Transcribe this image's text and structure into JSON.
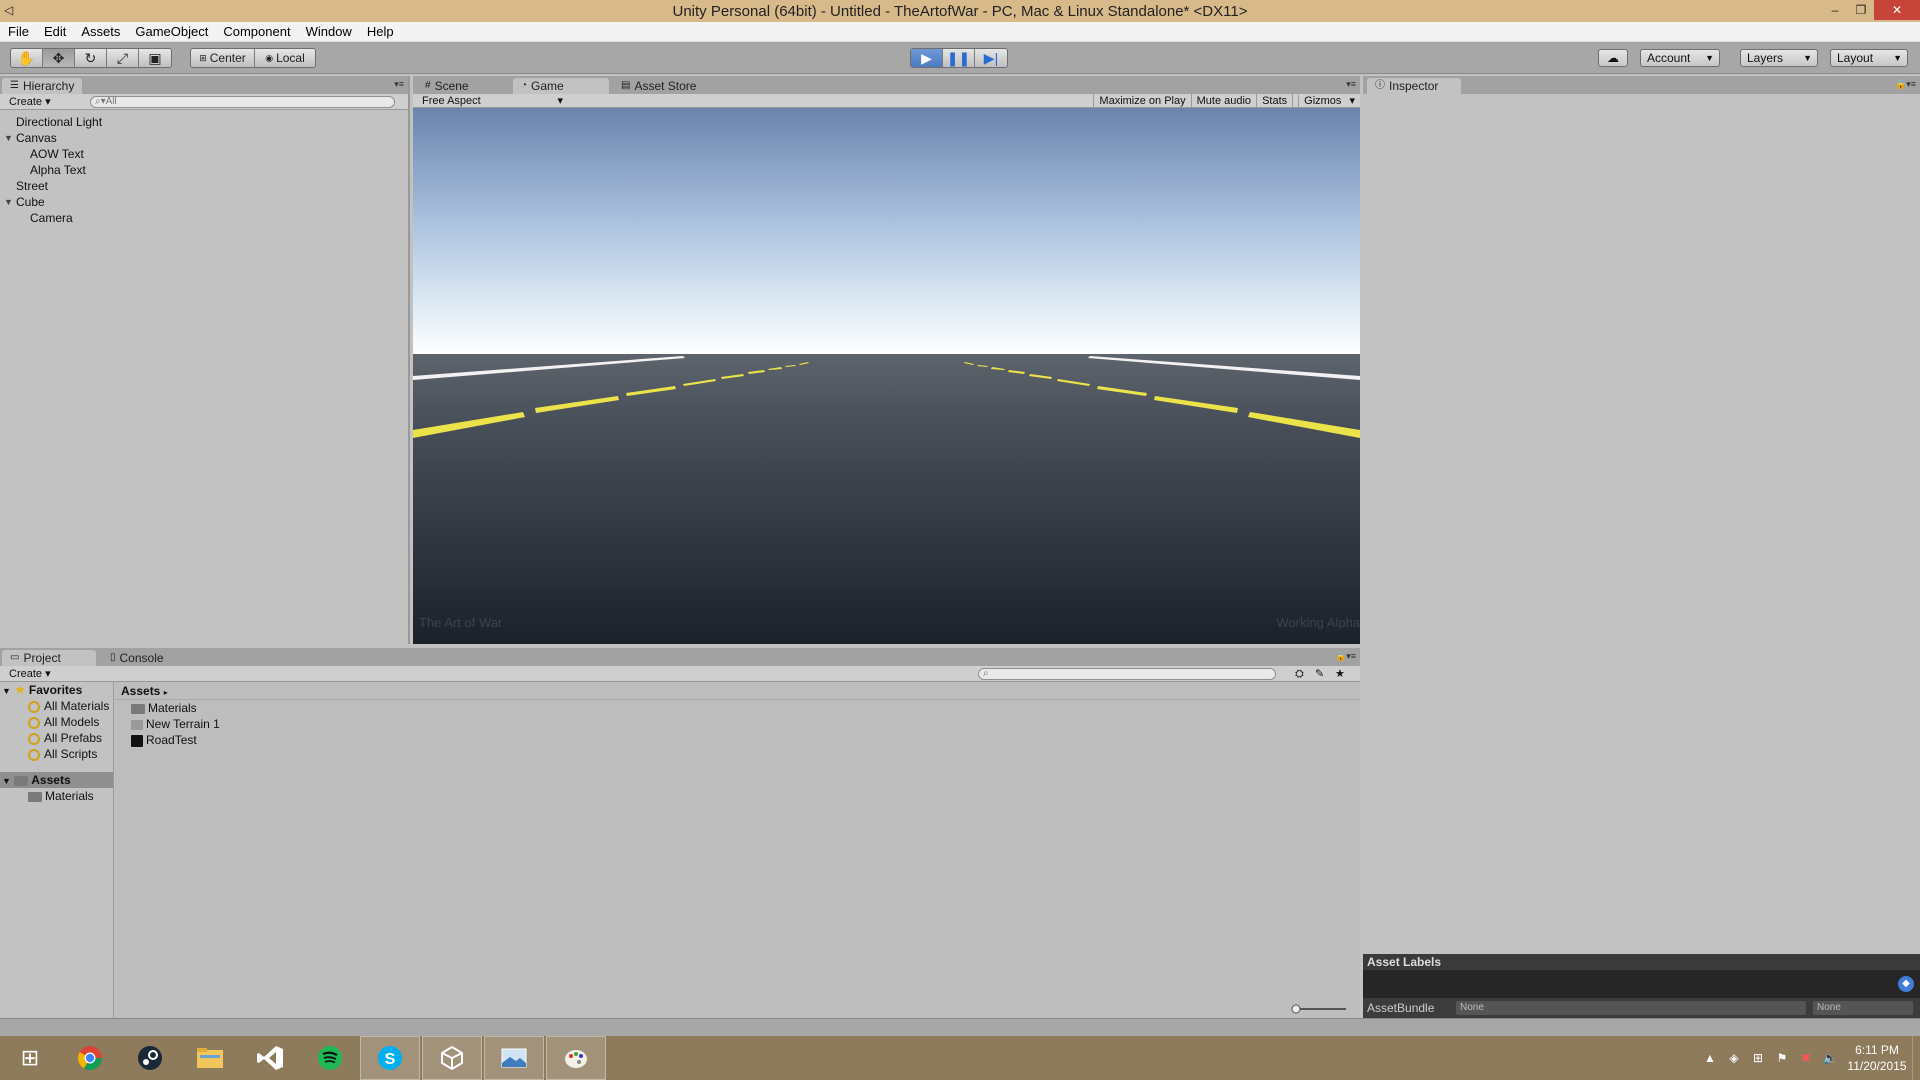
{
  "window": {
    "title": "Unity Personal (64bit) - Untitled - TheArtofWar - PC, Mac & Linux Standalone* <DX11>",
    "minimize": "–",
    "restore": "❐",
    "close": "✕"
  },
  "menu": [
    "File",
    "Edit",
    "Assets",
    "GameObject",
    "Component",
    "Window",
    "Help"
  ],
  "toolbar": {
    "pivot_center": "Center",
    "pivot_local": "Local",
    "account": "Account",
    "layers": "Layers",
    "layout": "Layout"
  },
  "hierarchy": {
    "tab": "Hierarchy",
    "create": "Create",
    "search_placeholder": "All",
    "items": [
      {
        "label": "Directional Light",
        "depth": 0,
        "expandable": false
      },
      {
        "label": "Canvas",
        "depth": 0,
        "expandable": true
      },
      {
        "label": "AOW Text",
        "depth": 1,
        "expandable": false
      },
      {
        "label": "Alpha Text",
        "depth": 1,
        "expandable": false
      },
      {
        "label": "Street",
        "depth": 0,
        "expandable": false
      },
      {
        "label": "Cube",
        "depth": 0,
        "expandable": true
      },
      {
        "label": "Camera",
        "depth": 1,
        "expandable": false
      }
    ]
  },
  "center_tabs": {
    "scene": "Scene",
    "game": "Game",
    "asset_store": "Asset Store"
  },
  "game": {
    "aspect": "Free Aspect",
    "maximize": "Maximize on Play",
    "mute": "Mute audio",
    "stats": "Stats",
    "gizmos": "Gizmos",
    "overlay_left": "The Art of War",
    "overlay_right": "Working Alpha"
  },
  "inspector": {
    "tab": "Inspector",
    "asset_labels": "Asset Labels",
    "asset_bundle": "AssetBundle",
    "bundle_value": "None",
    "bundle_variant": "None"
  },
  "project": {
    "tab_project": "Project",
    "tab_console": "Console",
    "create": "Create",
    "favorites": "Favorites",
    "favorite_items": [
      "All Materials",
      "All Models",
      "All Prefabs",
      "All Scripts"
    ],
    "assets_root": "Assets",
    "tree_children": [
      "Materials"
    ],
    "path": "Assets",
    "assets": [
      {
        "name": "Materials",
        "icon": "folder-icon"
      },
      {
        "name": "New Terrain 1",
        "icon": "terrain-icon"
      },
      {
        "name": "RoadTest",
        "icon": "scene-icon"
      }
    ]
  },
  "taskbar": {
    "apps": [
      "windows-start",
      "chrome",
      "steam",
      "file-explorer",
      "visual-studio",
      "spotify",
      "skype",
      "unity",
      "photos",
      "paint"
    ],
    "time": "6:11 PM",
    "date": "11/20/2015"
  },
  "colors": {
    "titlebar": "#d8b98a",
    "play_active": "#4c7bc0",
    "close": "#c7443a"
  }
}
